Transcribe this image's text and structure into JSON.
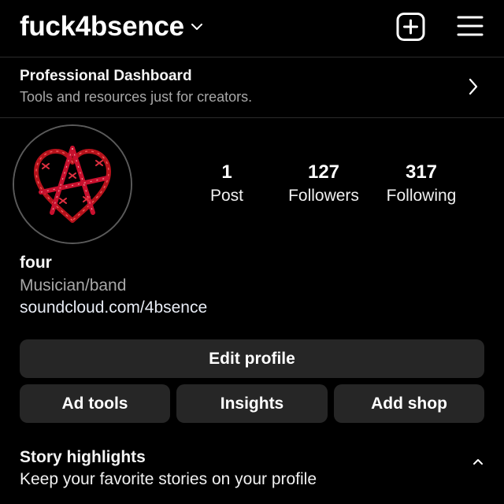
{
  "header": {
    "username": "fuck4bsence",
    "username_dropdown_icon": "chevron-down-icon",
    "new_post_icon": "plus-square-icon",
    "menu_icon": "hamburger-menu-icon"
  },
  "dashboard": {
    "title": "Professional Dashboard",
    "subtitle": "Tools and resources just for creators.",
    "icon": "chevron-right-icon"
  },
  "profile": {
    "avatar_icon": "barbed-wire-heart-anarchy-avatar",
    "stats": [
      {
        "value": "1",
        "label": "Post"
      },
      {
        "value": "127",
        "label": "Followers"
      },
      {
        "value": "317",
        "label": "Following"
      }
    ],
    "name": "four",
    "category": "Musician/band",
    "link": "soundcloud.com/4bsence"
  },
  "actions": {
    "edit_profile": "Edit profile",
    "ad_tools": "Ad tools",
    "insights": "Insights",
    "add_shop": "Add shop"
  },
  "highlights": {
    "title": "Story highlights",
    "subtitle": "Keep your favorite stories on your profile",
    "toggle_icon": "chevron-up-icon"
  },
  "colors": {
    "background": "#000000",
    "button_bg": "#262626",
    "secondary_text": "#a8a8a8",
    "avatar_accent": "#c8102e"
  }
}
